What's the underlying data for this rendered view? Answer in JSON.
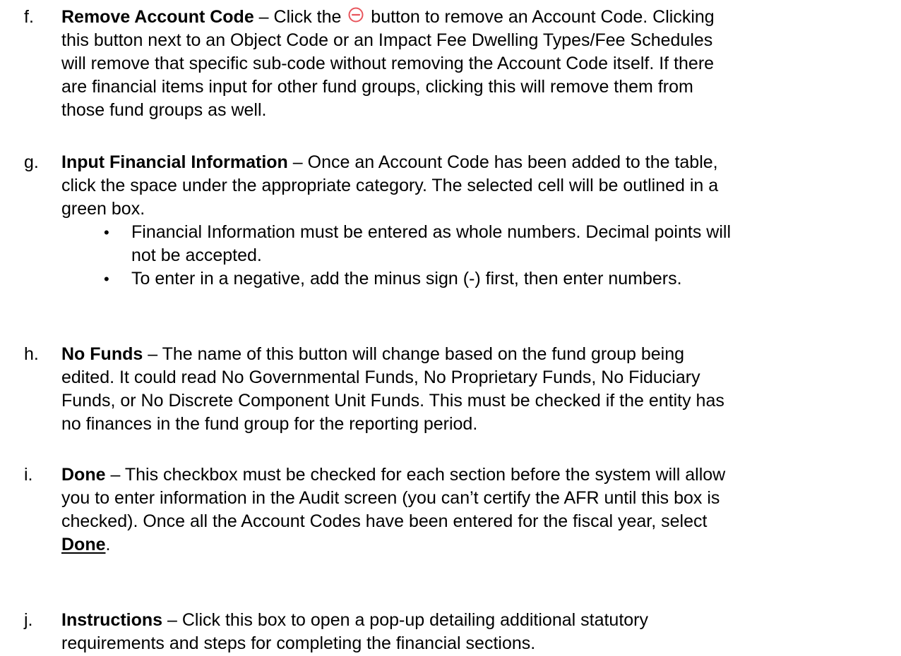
{
  "items": [
    {
      "marker": "f.",
      "title": "Remove Account Code",
      "dash": " – ",
      "line1_before_icon": "Click the ",
      "line1_after_icon": " button to remove an Account Code. Clicking",
      "lines": [
        "this button next to an Object Code or an Impact Fee Dwelling Types/Fee Schedules",
        "will remove that specific sub-code without removing the Account Code itself. If there",
        "are financial items input for other fund groups, clicking this will remove them from",
        "those fund groups as well."
      ],
      "icon": "remove-circle-icon"
    },
    {
      "marker": "g.",
      "title": "Input Financial Information",
      "dash": " – ",
      "line1_rest": "Once an Account Code has been added to the table,",
      "lines": [
        "click the space under the appropriate category. The selected cell will be outlined in a",
        "green box."
      ],
      "bullets": [
        {
          "lines": [
            "Financial Information must be entered as whole numbers. Decimal points will",
            "not be accepted."
          ]
        },
        {
          "lines": [
            "To enter in a negative, add the minus sign (-) first, then enter numbers."
          ]
        }
      ],
      "bullet_symbol": "•"
    },
    {
      "marker": "h.",
      "title": "No Funds",
      "dash": " – ",
      "line1_rest": "The name of this button will change based on the fund group being",
      "lines": [
        "edited. It could read No Governmental Funds, No Proprietary Funds, No Fiduciary",
        "Funds, or No Discrete Component Unit Funds. This must be checked if the entity has",
        "no finances in the fund group for the reporting period."
      ]
    },
    {
      "marker": "i.",
      "title": "Done",
      "dash": " – ",
      "line1_rest": "This checkbox must be checked for each section before the system will allow",
      "lines": [
        "you to enter information in the Audit screen (you can’t certify the AFR until this box is",
        "checked). Once all the Account Codes have been entered for the fiscal year, select"
      ],
      "final_bold_underlined": "Done",
      "final_period": "."
    },
    {
      "marker": "j.",
      "title": "Instructions",
      "dash": " – ",
      "line1_rest": "Click this box to open a pop-up detailing additional statutory",
      "lines": [
        "requirements and steps for completing the financial sections."
      ]
    }
  ],
  "colors": {
    "text": "#000000",
    "icon": "#e8565d"
  }
}
